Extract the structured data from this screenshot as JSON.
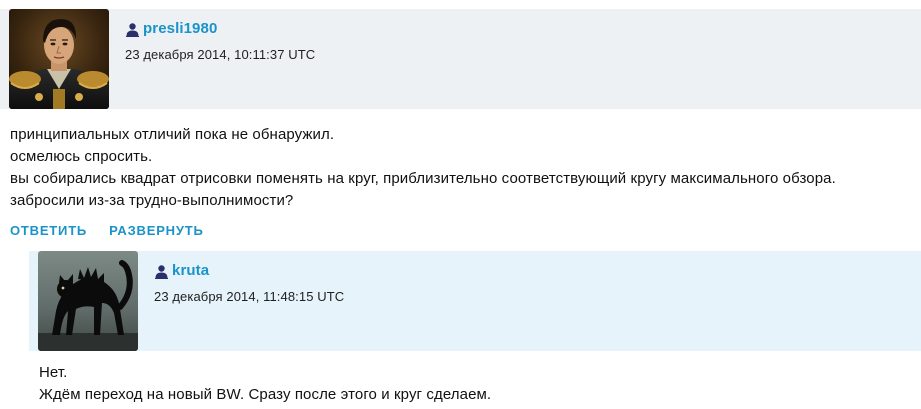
{
  "comment": {
    "username": "presli1980",
    "timestamp": "23 декабря 2014, 10:11:37 UTC",
    "avatar": "user-avatar-portrait",
    "body": [
      "принципиальных отличий пока не обнаружил.",
      "осмелюсь спросить.",
      "вы собирались квадрат отрисовки поменять на круг, приблизительно соответствующий кругу максимального обзора.",
      "забросили из-за трудно-выполнимости?"
    ],
    "actions": {
      "reply": "ОТВЕТИТЬ",
      "expand": "РАЗВЕРНУТЬ"
    }
  },
  "reply": {
    "username": "kruta",
    "timestamp": "23 декабря 2014, 11:48:15 UTC",
    "avatar": "user-avatar-black-cat",
    "body": [
      "Нет.",
      "Ждём переход на новый BW. Сразу после этого и круг сделаем."
    ]
  },
  "colors": {
    "accent": "#1a93c9",
    "header_bg": "#eef1f3",
    "reply_header_bg": "#e6f3fa"
  },
  "icons": {
    "user": "user-icon"
  }
}
